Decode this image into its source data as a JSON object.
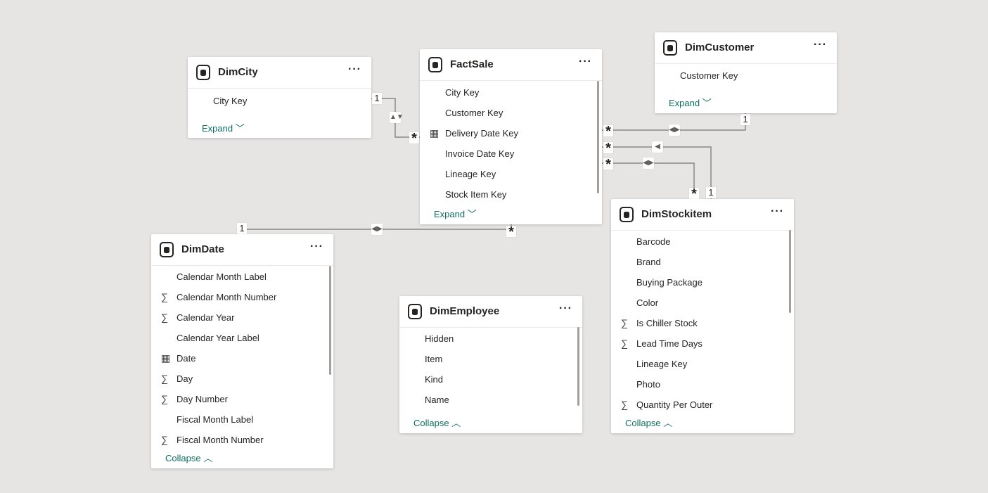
{
  "tables": {
    "dimcity": {
      "title": "DimCity",
      "more": "···",
      "fields": [
        "City Key"
      ],
      "footer": "Expand ﹀"
    },
    "factsale": {
      "title": "FactSale",
      "more": "···",
      "fields": [
        "City Key",
        "Customer Key",
        "Delivery Date Key",
        "Invoice Date Key",
        "Lineage Key",
        "Stock Item Key"
      ],
      "footer": "Expand ﹀"
    },
    "dimcustomer": {
      "title": "DimCustomer",
      "more": "···",
      "fields": [
        "Customer Key"
      ],
      "footer": "Expand ﹀"
    },
    "dimstockitem": {
      "title": "DimStockitem",
      "more": "···",
      "fields": [
        "Barcode",
        "Brand",
        "Buying Package",
        "Color",
        "Is Chiller Stock",
        "Lead Time Days",
        "Lineage Key",
        "Photo",
        "Quantity Per Outer"
      ],
      "footer": "Collapse ︿"
    },
    "dimdate": {
      "title": "DimDate",
      "more": "···",
      "fields": [
        "Calendar Month Label",
        "Calendar Month Number",
        "Calendar Year",
        "Calendar Year Label",
        "Date",
        "Day",
        "Day Number",
        "Fiscal Month Label",
        "Fiscal Month Number"
      ],
      "footer": "Collapse ︿"
    },
    "dimemployee": {
      "title": "DimEmployee",
      "more": "···",
      "fields": [
        "Hidden",
        "Item",
        "Kind",
        "Name"
      ],
      "footer": "Collapse ︿"
    }
  },
  "icons": {
    "sum": "∑",
    "calendar": "▦"
  },
  "cardinality": {
    "one": "1",
    "many": "*"
  },
  "direction": {
    "both": "◀▶",
    "single": "◀",
    "vertical": "▲▼"
  }
}
